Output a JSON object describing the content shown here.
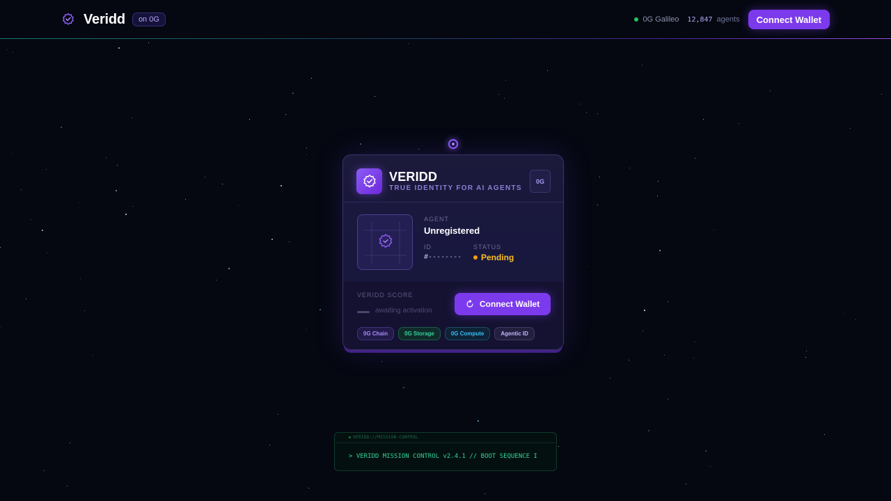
{
  "header": {
    "brand_name": "Veridd",
    "brand_badge": "on 0G",
    "network_name": "0G Galileo",
    "agents_count": "12,847",
    "agents_label": "agents",
    "connect_label": "Connect Wallet"
  },
  "card": {
    "title": "VERIDD",
    "tagline": "TRUE IDENTITY FOR AI AGENTS",
    "chain_chip": "0G",
    "agent_label": "AGENT",
    "agent_name": "Unregistered",
    "id_label": "ID",
    "id_value": "#--------",
    "status_label": "STATUS",
    "status_value": "Pending",
    "score_label": "VERIDD SCORE",
    "score_sub": "awaiting activation",
    "connect_label": "Connect Wallet",
    "tags": [
      "0G Chain",
      "0G Storage",
      "0G Compute",
      "Agentic ID"
    ]
  },
  "terminal": {
    "title": "VERIDD://MISSION-CONTROL",
    "line": "> VERIDD MISSION CONTROL v2.4.1 // BOOT SEQUENCE I"
  },
  "colors": {
    "background": "#050811",
    "accent": "#7c3aed",
    "pending": "#fbbf24",
    "network_online": "#22c55e",
    "terminal_text": "#34d399"
  },
  "icons": {
    "brand": "verified-badge-icon",
    "connect": "refresh-icon",
    "network": "status-dot-icon"
  }
}
